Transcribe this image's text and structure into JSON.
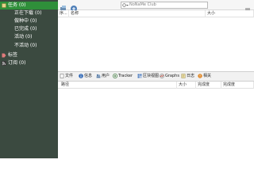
{
  "sidebar": {
    "items": [
      {
        "label": "任务 (0)",
        "icon": "tasks-icon",
        "selected": true
      },
      {
        "label": "正在下载 (0)"
      },
      {
        "label": "做种中 (0)"
      },
      {
        "label": "已完成 (0)"
      },
      {
        "label": "活动 (0)"
      },
      {
        "label": "不活动 (0)"
      },
      {
        "label": "标签",
        "icon": "tag-icon"
      },
      {
        "label": "订阅 (0)",
        "icon": "rss-icon"
      }
    ]
  },
  "toolbar": {
    "search_placeholder": "NoNaMe Club"
  },
  "top_table": {
    "columns": [
      "序...",
      "名称",
      "大小"
    ]
  },
  "tabs": [
    {
      "label": "文件",
      "icon": "file-icon"
    },
    {
      "label": "信息",
      "icon": "info-icon"
    },
    {
      "label": "用户",
      "icon": "users-icon"
    },
    {
      "label": "Tracker",
      "icon": "tracker-icon"
    },
    {
      "label": "区块视图",
      "icon": "pieces-icon"
    },
    {
      "label": "Graphs",
      "icon": "graphs-icon"
    },
    {
      "label": "日志",
      "icon": "log-icon"
    },
    {
      "label": "相关",
      "icon": "related-icon"
    }
  ],
  "bottom_table": {
    "columns": [
      "路径",
      "大小",
      "完成度",
      "完成度"
    ]
  },
  "colors": {
    "sidebar_bg": "#3b4a40",
    "selected_bg": "#2f8f3a",
    "toolbar_bg": "#f6f6f6"
  }
}
